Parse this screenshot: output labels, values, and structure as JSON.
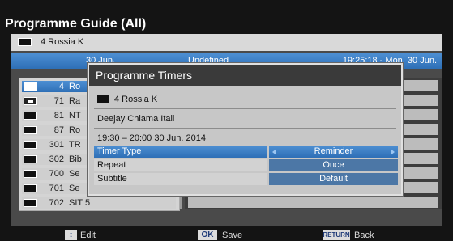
{
  "guide": {
    "title": "Programme Guide (All)",
    "current_channel": "4  Rossia K",
    "date": "30 Jun.",
    "programme": "Undefined",
    "clock": "19:25:18 - Mon, 30 Jun."
  },
  "channels": [
    {
      "num": "4",
      "name": "Ro",
      "type": "tv",
      "selected": true
    },
    {
      "num": "71",
      "name": "Ra",
      "type": "radio",
      "selected": false
    },
    {
      "num": "81",
      "name": "NT",
      "type": "tv",
      "selected": false
    },
    {
      "num": "87",
      "name": "Ro",
      "type": "tv",
      "selected": false
    },
    {
      "num": "301",
      "name": "TR",
      "type": "tv",
      "selected": false
    },
    {
      "num": "302",
      "name": "Bib",
      "type": "tv",
      "selected": false
    },
    {
      "num": "700",
      "name": "Se",
      "type": "tv",
      "selected": false
    },
    {
      "num": "701",
      "name": "Se",
      "type": "tv",
      "selected": false
    },
    {
      "num": "702",
      "name": "SIT 5",
      "type": "tv",
      "selected": false
    }
  ],
  "modal": {
    "title": "Programme Timers",
    "channel": "4  Rossia K",
    "programme": "Deejay Chiama Itali",
    "time": "19:30 – 20:00 30 Jun. 2014",
    "options": [
      {
        "label": "Timer Type",
        "value": "Reminder",
        "active": true
      },
      {
        "label": "Repeat",
        "value": "Once",
        "active": false
      },
      {
        "label": "Subtitle",
        "value": "Default",
        "active": false
      }
    ]
  },
  "footer": {
    "edit_label": "Edit",
    "ok_icon": "OK",
    "save_label": "Save",
    "return_icon": "RETURN",
    "back_label": "Back"
  },
  "colors": {
    "highlight": "#3a7cc4",
    "value_bg": "#4c77a6"
  }
}
